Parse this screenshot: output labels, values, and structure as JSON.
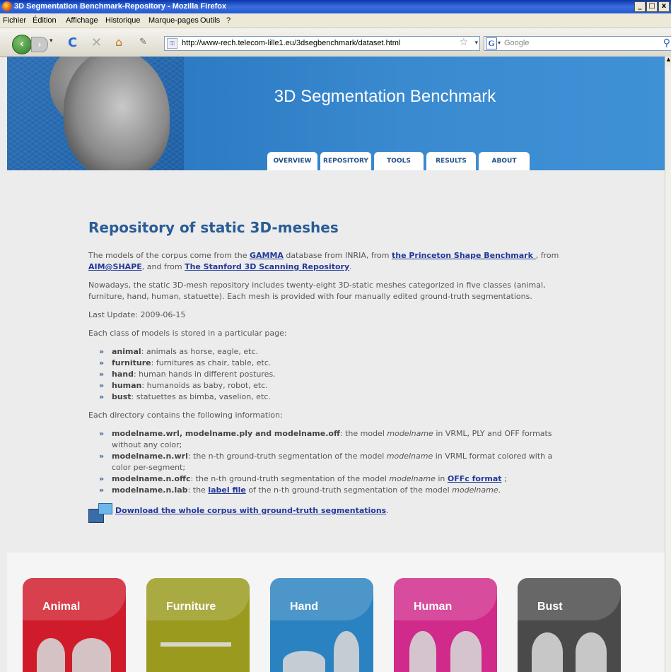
{
  "window": {
    "title": "3D Segmentation Benchmark-Repository - Mozilla Firefox",
    "buttons": [
      "_",
      "□",
      "x"
    ]
  },
  "menu": [
    "Fichier",
    "Édition",
    "Affichage",
    "Historique",
    "Marque-pages",
    "Outils",
    "?"
  ],
  "nav": {
    "back": "‹",
    "forward": "›",
    "reload": "C",
    "stop": "✕",
    "home": "⌂",
    "bookmark": "✎",
    "url": "http://www-rech.telecom-lille1.eu/3dsegbenchmark/dataset.html",
    "search_placeholder": "Google"
  },
  "banner": {
    "title": "3D Segmentation Benchmark"
  },
  "tabs": [
    "OVERVIEW",
    "REPOSITORY",
    "TOOLS",
    "RESULTS",
    "ABOUT"
  ],
  "content": {
    "heading": "Repository of static 3D-meshes",
    "intro": {
      "t1": "The models of the corpus come from the ",
      "gamma": "GAMMA",
      "t2": " database from INRIA, from ",
      "princeton": "the Princeton Shape Benchmark ",
      "t3": ", from ",
      "aim": "AIM@SHAPE",
      "t4": ", and from ",
      "stanford": "The Stanford 3D Scanning Repository",
      "t5": "."
    },
    "para2": "Nowadays, the static 3D-mesh repository includes twenty-eight 3D-static meshes categorized in five classes (animal, furniture, hand, human, statuette). Each mesh is provided with four manually edited ground-truth segmentations.",
    "last_update": "Last Update: 2009-06-15",
    "classes_intro": "Each class of models is stored in a particular page:",
    "classes": [
      {
        "name": "animal",
        "desc": ": animals as horse, eagle, etc."
      },
      {
        "name": "furniture",
        "desc": ": furnitures as chair, table, etc."
      },
      {
        "name": "hand",
        "desc": ": human hands in different postures."
      },
      {
        "name": "human",
        "desc": ": humanoids as baby, robot, etc."
      },
      {
        "name": "bust",
        "desc": ": statuettes as bimba, vaselion, etc."
      }
    ],
    "dir_intro": "Each directory contains the following information:",
    "dir": {
      "i1a": "modelname.wrl, modelname.ply and modelname.off",
      "i1b": ": the model ",
      "i1c": "modelname",
      "i1d": " in VRML, PLY and OFF formats without any color;",
      "i2a": "modelname.n.wrl",
      "i2b": ": the n-th ground-truth segmentation of the model ",
      "i2c": "modelname",
      "i2d": " in VRML format colored with a color per-segment;",
      "i3a": "modelname.n.offc",
      "i3b": ": the n-th ground-truth segmentation of the model ",
      "i3c": "modelname",
      "i3d": " in ",
      "i3e": "OFFc format",
      "i3f": " ;",
      "i4a": "modelname.n.lab",
      "i4b": ": the ",
      "i4c": "label file",
      "i4d": " of the n-th ground-truth segmentation of the model ",
      "i4e": "modelname",
      "i4f": "."
    },
    "download": "Download the whole corpus with ground-truth segmentations",
    "download_tail": "."
  },
  "cards": [
    {
      "label": "Animal",
      "color": "#d01c2a"
    },
    {
      "label": "Furniture",
      "color": "#9a9a1e"
    },
    {
      "label": "Hand",
      "color": "#2a82c0"
    },
    {
      "label": "Human",
      "color": "#d02a8a"
    },
    {
      "label": "Bust",
      "color": "#4a4a4a"
    }
  ],
  "colors": {
    "banner": "#2a78c0",
    "heading": "#2a5c96",
    "link": "#22389a",
    "page_bg": "#ececec"
  }
}
